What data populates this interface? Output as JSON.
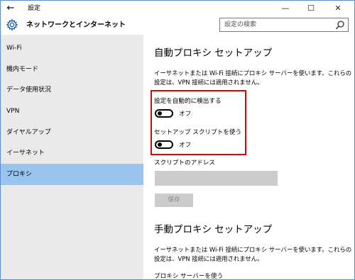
{
  "window": {
    "title": "設定",
    "back_glyph": "←",
    "minimize_glyph": "—",
    "maximize_glyph": "☐",
    "close_glyph": "✕"
  },
  "header": {
    "title": "ネットワークとインターネット",
    "icon": "gear-icon"
  },
  "search": {
    "placeholder": "設定の検索",
    "icon": "search-icon"
  },
  "sidebar": {
    "items": [
      {
        "label": "Wi-Fi",
        "selected": false
      },
      {
        "label": "機内モード",
        "selected": false
      },
      {
        "label": "データ使用状況",
        "selected": false
      },
      {
        "label": "VPN",
        "selected": false
      },
      {
        "label": "ダイヤルアップ",
        "selected": false
      },
      {
        "label": "イーサネット",
        "selected": false
      },
      {
        "label": "プロキシ",
        "selected": true
      }
    ]
  },
  "auto_proxy": {
    "title": "自動プロキシ セットアップ",
    "description": "イーサネットまたは Wi-Fi 接続にプロキシ サーバーを使います。これらの設定は、VPN 接続には適用されません。",
    "detect_label": "設定を自動的に検出する",
    "detect_state": "オフ",
    "script_label": "セットアップ スクリプトを使う",
    "script_state": "オフ",
    "address_label": "スクリプトのアドレス",
    "address_value": "",
    "save_label": "保存"
  },
  "manual_proxy": {
    "title": "手動プロキシ セットアップ",
    "description": "イーサネットまたは Wi-Fi 接続にプロキシ サーバーを使います。これらの設定は、VPN 接続には適用されません。",
    "use_server_label": "プロキシ サーバーを使う"
  },
  "colors": {
    "selected_nav": "#99c4ee",
    "sidebar_bg": "#eaeaea",
    "highlight_border": "#e60000"
  }
}
